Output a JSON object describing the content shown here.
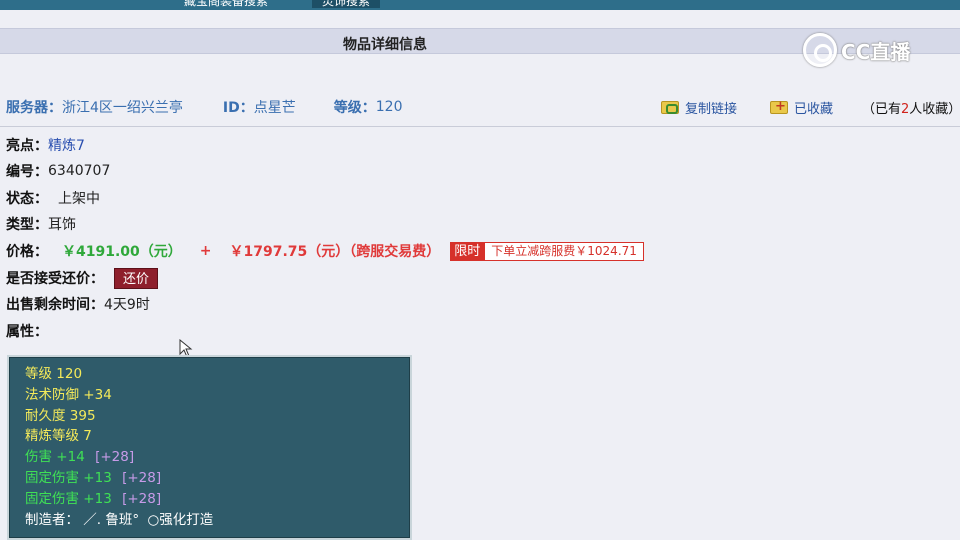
{
  "topnav": {
    "tabs": [
      {
        "label": "藏宝阁装备搜索"
      },
      {
        "label": "灵饰搜索"
      }
    ]
  },
  "header": {
    "title": "物品详细信息"
  },
  "watermark": {
    "text": "CC直播"
  },
  "info": {
    "server_label": "服务器：",
    "server_value": "浙江4区一绍兴兰亭",
    "id_label": "ID：",
    "id_value": "点星芒",
    "level_label": "等级：",
    "level_value": "120"
  },
  "actions": {
    "copy_link": "复制链接",
    "favorited": "已收藏",
    "fav_prefix": "（已有",
    "fav_count": "2",
    "fav_suffix": "人收藏）"
  },
  "details": {
    "highlight_label": "亮点：",
    "highlight_value": "精炼7",
    "serial_label": "编号：",
    "serial_value": "6340707",
    "status_label": "状态：",
    "status_value": "上架中",
    "type_label": "类型：",
    "type_value": "耳饰",
    "price_label": "价格：",
    "price_main": "￥4191.00（元）",
    "price_plus": "+",
    "price_fee": "￥1797.75（元）（跨服交易费）",
    "limit_tag": "限时",
    "discount_text": "下单立减跨服费￥1024.71",
    "bargain_label": "是否接受还价：",
    "bargain_button": "还价",
    "remaining_label": "出售剩余时间：",
    "remaining_value": "4天9时",
    "attr_label": "属性："
  },
  "attributes": {
    "lines": [
      {
        "text": "等级 120",
        "color": "#f4ea5a"
      },
      {
        "text": "法术防御 +34",
        "color": "#f4ea5a"
      },
      {
        "text": "耐久度 395",
        "color": "#f4ea5a"
      },
      {
        "text": "精炼等级 7",
        "color": "#f4ea5a"
      }
    ],
    "special": [
      {
        "name": "伤害 +14",
        "bonus": "[+28]"
      },
      {
        "name": "固定伤害 +13",
        "bonus": "[+28]"
      },
      {
        "name": "固定伤害 +13",
        "bonus": "[+28]"
      }
    ],
    "maker_label": "制造者：",
    "maker_value": "／. 鲁班°",
    "maker_suffix": "○强化打造"
  }
}
